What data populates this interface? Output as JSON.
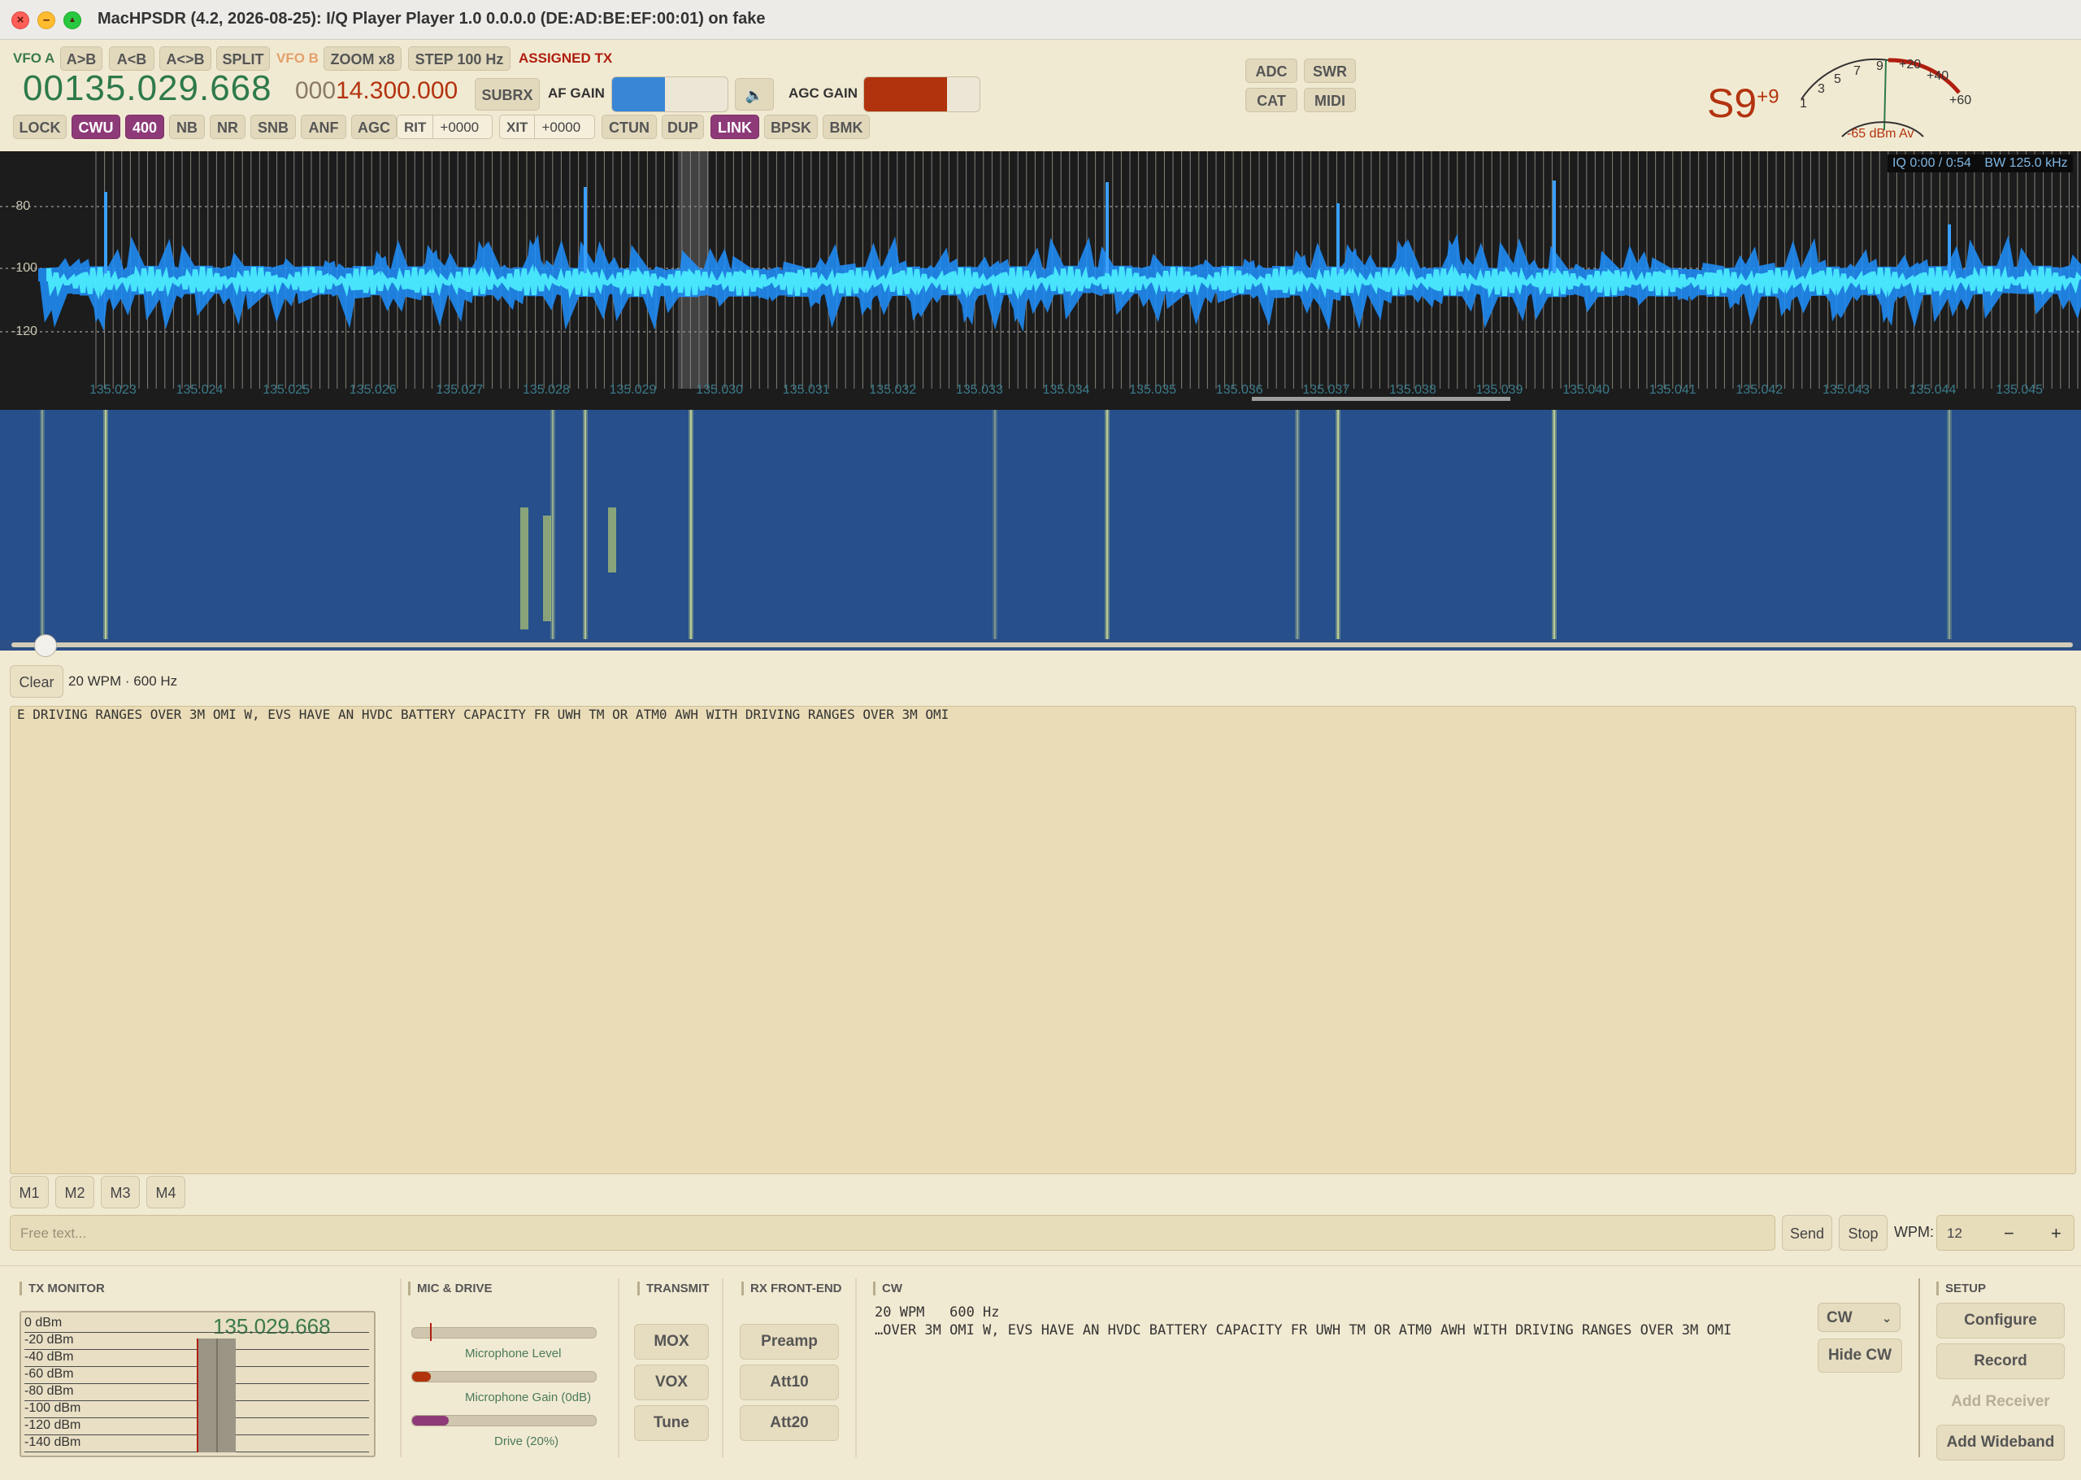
{
  "window": {
    "title": "MacHPSDR (4.2, 2026-08-25): I/Q Player Player 1.0 0.0.0.0 (DE:AD:BE:EF:00:01) on fake"
  },
  "vfo": {
    "vfo_a_label": "VFO A",
    "a_to_b": "A>B",
    "a_from_b": "A<B",
    "a_swap_b": "A<>B",
    "split": "SPLIT",
    "vfo_b_label": "VFO B",
    "zoom": "ZOOM x8",
    "step": "STEP 100 Hz",
    "assigned_tx": "ASSIGNED TX",
    "freq_a": "00135.029.668",
    "freq_b_prefix": "000",
    "freq_b": "14.300.000",
    "subrx": "SUBRX",
    "af_gain_label": "AF GAIN",
    "agc_gain_label": "AGC GAIN",
    "af_gain_level": 0.46,
    "agc_gain_level": 0.72
  },
  "toolbar": {
    "lock": "LOCK",
    "cwu": "CWU",
    "bw": "400",
    "nb": "NB",
    "nr": "NR",
    "snb": "SNB",
    "anf": "ANF",
    "agc": "AGC",
    "rit": "RIT",
    "rit_value": "+0000",
    "xit": "XIT",
    "xit_value": "+0000",
    "ctun": "CTUN",
    "dup": "DUP",
    "link": "LINK",
    "bpsk": "BPSK",
    "bmk": "BMK"
  },
  "status_buttons": {
    "adc": "ADC",
    "swr": "SWR",
    "cat": "CAT",
    "midi": "MIDI"
  },
  "meter": {
    "s_reading": "S9",
    "s_over": "+9",
    "scale": [
      "1",
      "3",
      "5",
      "7",
      "9",
      "+20",
      "+40",
      "+60"
    ],
    "avg": "-65 dBm Av",
    "colors": {
      "low": "#333333",
      "high": "#b01e10",
      "needle": "#2e7a4a"
    }
  },
  "spectrum": {
    "iq_status": "IQ 0:00 / 0:54",
    "bw_label": "BW 125.0 kHz",
    "db_labels": [
      "-80",
      "-100",
      "-120"
    ],
    "freq_labels": [
      "135.023",
      "135.024",
      "135.025",
      "135.026",
      "135.027",
      "135.028",
      "135.029",
      "135.030",
      "135.031",
      "135.032",
      "135.033",
      "135.034",
      "135.035",
      "135.036",
      "135.037",
      "135.038",
      "135.039",
      "135.040",
      "135.041",
      "135.042",
      "135.043",
      "135.044",
      "135.045"
    ],
    "colors": {
      "background": "#1c1c1c",
      "trace": "#1e90ff",
      "trace_core": "#4df0ff",
      "waterfall": "#264f8c",
      "signal": "#e7f07a"
    }
  },
  "cw_decoder": {
    "clear": "Clear",
    "status": "20 WPM · 600 Hz",
    "text": "E DRIVING RANGES OVER 3M OMI W, EVS HAVE AN HVDC BATTERY CAPACITY FR UWH TM OR ATM0 AWH WITH DRIVING RANGES OVER 3M OMI"
  },
  "memories": [
    "M1",
    "M2",
    "M3",
    "M4"
  ],
  "tx_entry": {
    "placeholder": "Free text...",
    "send": "Send",
    "stop": "Stop",
    "wpm_label": "WPM:",
    "wpm_value": "12",
    "minus": "−",
    "plus": "+"
  },
  "tx_monitor": {
    "title": "TX MONITOR",
    "freq": "135.029.668",
    "levels": [
      "0 dBm",
      "-20 dBm",
      "-40 dBm",
      "-60 dBm",
      "-80 dBm",
      "-100 dBm",
      "-120 dBm",
      "-140 dBm"
    ]
  },
  "mic_drive": {
    "title": "MIC & DRIVE",
    "mic_level_label": "Microphone Level",
    "mic_gain_label": "Microphone Gain (0dB)",
    "drive_label": "Drive (20%)",
    "mic_level": 0.0,
    "mic_gain": 0.1,
    "drive": 0.2
  },
  "transmit": {
    "title": "TRANSMIT",
    "mox": "MOX",
    "vox": "VOX",
    "tune": "Tune"
  },
  "rx_front_end": {
    "title": "RX FRONT-END",
    "preamp": "Preamp",
    "att10": "Att10",
    "att20": "Att20"
  },
  "cw_panel": {
    "title": "CW",
    "line1": "20 WPM   600 Hz",
    "line2": "…OVER 3M OMI W, EVS HAVE AN HVDC BATTERY CAPACITY FR UWH TM OR ATM0 AWH WITH DRIVING RANGES OVER 3M OMI",
    "mode": "CW",
    "hide": "Hide CW"
  },
  "setup": {
    "title": "SETUP",
    "configure": "Configure",
    "record": "Record",
    "add_receiver": "Add Receiver",
    "add_wideband": "Add Wideband"
  }
}
